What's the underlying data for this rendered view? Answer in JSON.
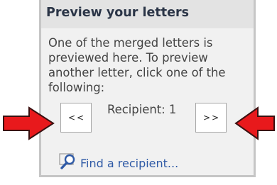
{
  "panel": {
    "title": "Preview your letters",
    "description_lines": [
      "One of the merged letters is",
      "previewed here. To preview",
      "another letter, click one of the",
      "following:"
    ],
    "prev_button_label": "<<",
    "next_button_label": ">>",
    "recipient_label": "Recipient: 1",
    "find_recipient_label": "Find a recipient..."
  },
  "icons": {
    "find": "magnifier-search-icon",
    "left_callout": "red-arrow-right-icon",
    "right_callout": "red-arrow-left-icon"
  },
  "colors": {
    "callout_fill": "#e8191c",
    "link": "#2f5aa6",
    "title": "#2b3547"
  }
}
